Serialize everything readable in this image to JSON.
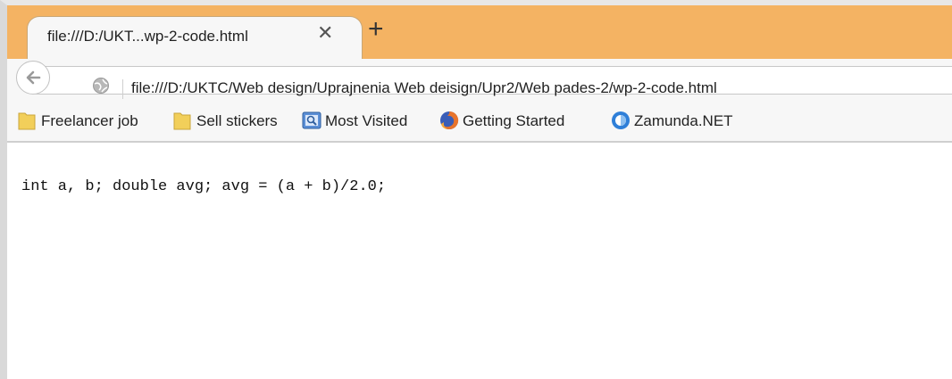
{
  "tab": {
    "title": "file:///D:/UKT...wp-2-code.html",
    "close_glyph": "✕",
    "new_tab_glyph": "+"
  },
  "navbar": {
    "url": "file:///D:/UKTC/Web design/Uprajnenia Web deisign/Upr2/Web pades-2/wp-2-code.html"
  },
  "bookmarks": [
    {
      "label": "Freelancer job",
      "icon": "folder-icon"
    },
    {
      "label": "Sell stickers",
      "icon": "folder-icon"
    },
    {
      "label": "Most Visited",
      "icon": "most-visited-icon"
    },
    {
      "label": "Getting Started",
      "icon": "firefox-icon"
    },
    {
      "label": "Zamunda.NET",
      "icon": "zamunda-icon"
    }
  ],
  "page": {
    "code": "int a, b; double avg; avg = (a + b)/2.0;"
  },
  "colors": {
    "tabstrip": "#f4b363",
    "chrome": "#f7f7f7",
    "folder": "#f2cf5a"
  }
}
